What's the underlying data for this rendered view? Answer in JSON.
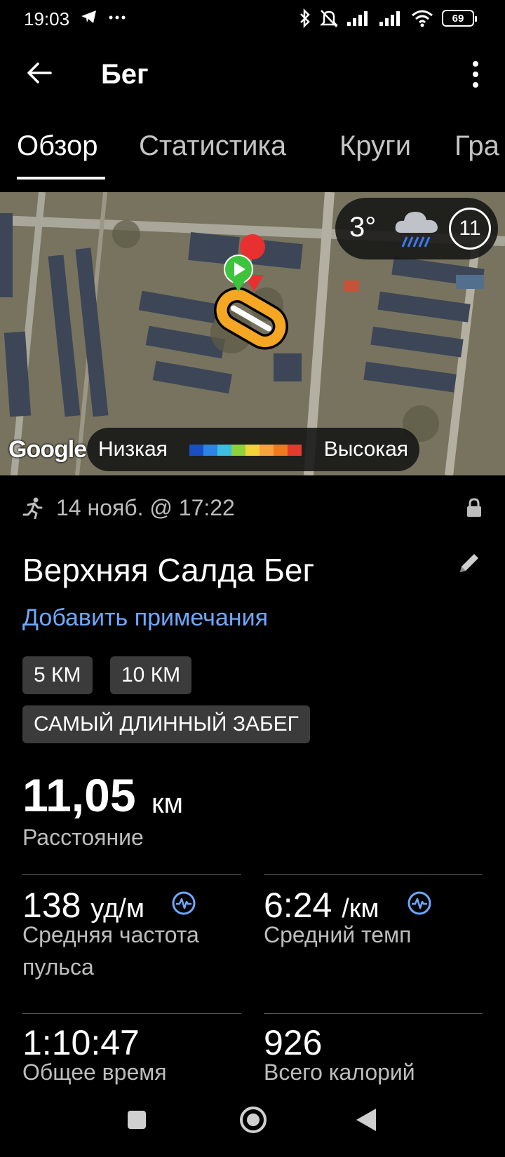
{
  "status_bar": {
    "time": "19:03",
    "battery": "69",
    "icons": [
      "telegram-icon",
      "more-dots-icon",
      "bluetooth-icon",
      "bell-off-icon",
      "signal-icon",
      "signal-icon",
      "wifi-icon",
      "battery-icon"
    ]
  },
  "app_bar": {
    "title": "Бег"
  },
  "tabs": [
    {
      "label": "Обзор",
      "active": true
    },
    {
      "label": "Статистика",
      "active": false
    },
    {
      "label": "Круги",
      "active": false
    },
    {
      "label": "Гра",
      "active": false
    }
  ],
  "map": {
    "weather": {
      "temperature": "3°",
      "wind_speed": "11",
      "condition_icon": "rain-cloud-icon"
    },
    "google_label": "Google",
    "legend": {
      "low_label": "Низкая",
      "high_label": "Высокая",
      "colors": [
        "#1a4fc4",
        "#2b84e6",
        "#3dbde0",
        "#8fd13a",
        "#f2d33a",
        "#f7a23a",
        "#ef7a1e",
        "#e53a2e"
      ]
    },
    "route_colors": {
      "route": "#f5a623",
      "start_marker": "#3cc43c",
      "end_marker": "#e83030"
    }
  },
  "activity": {
    "date": "14 нояб. @ 17:22",
    "title": "Верхняя Салда Бег",
    "add_notes_label": "Добавить примечания",
    "badges": [
      "5 КМ",
      "10 КМ",
      "САМЫЙ ДЛИННЫЙ ЗАБЕГ"
    ],
    "distance": {
      "value": "11,05",
      "unit": "км",
      "label": "Расстояние"
    },
    "stats": [
      {
        "value": "138",
        "unit": "уд/м",
        "label": "Средняя частота пульса"
      },
      {
        "value": "6:24",
        "unit": "/км",
        "label": "Средний темп"
      },
      {
        "value": "1:10:47",
        "unit": "",
        "label": "Общее время"
      },
      {
        "value": "926",
        "unit": "",
        "label": "Всего калорий"
      }
    ]
  },
  "accent_color": "#6ea8ff"
}
